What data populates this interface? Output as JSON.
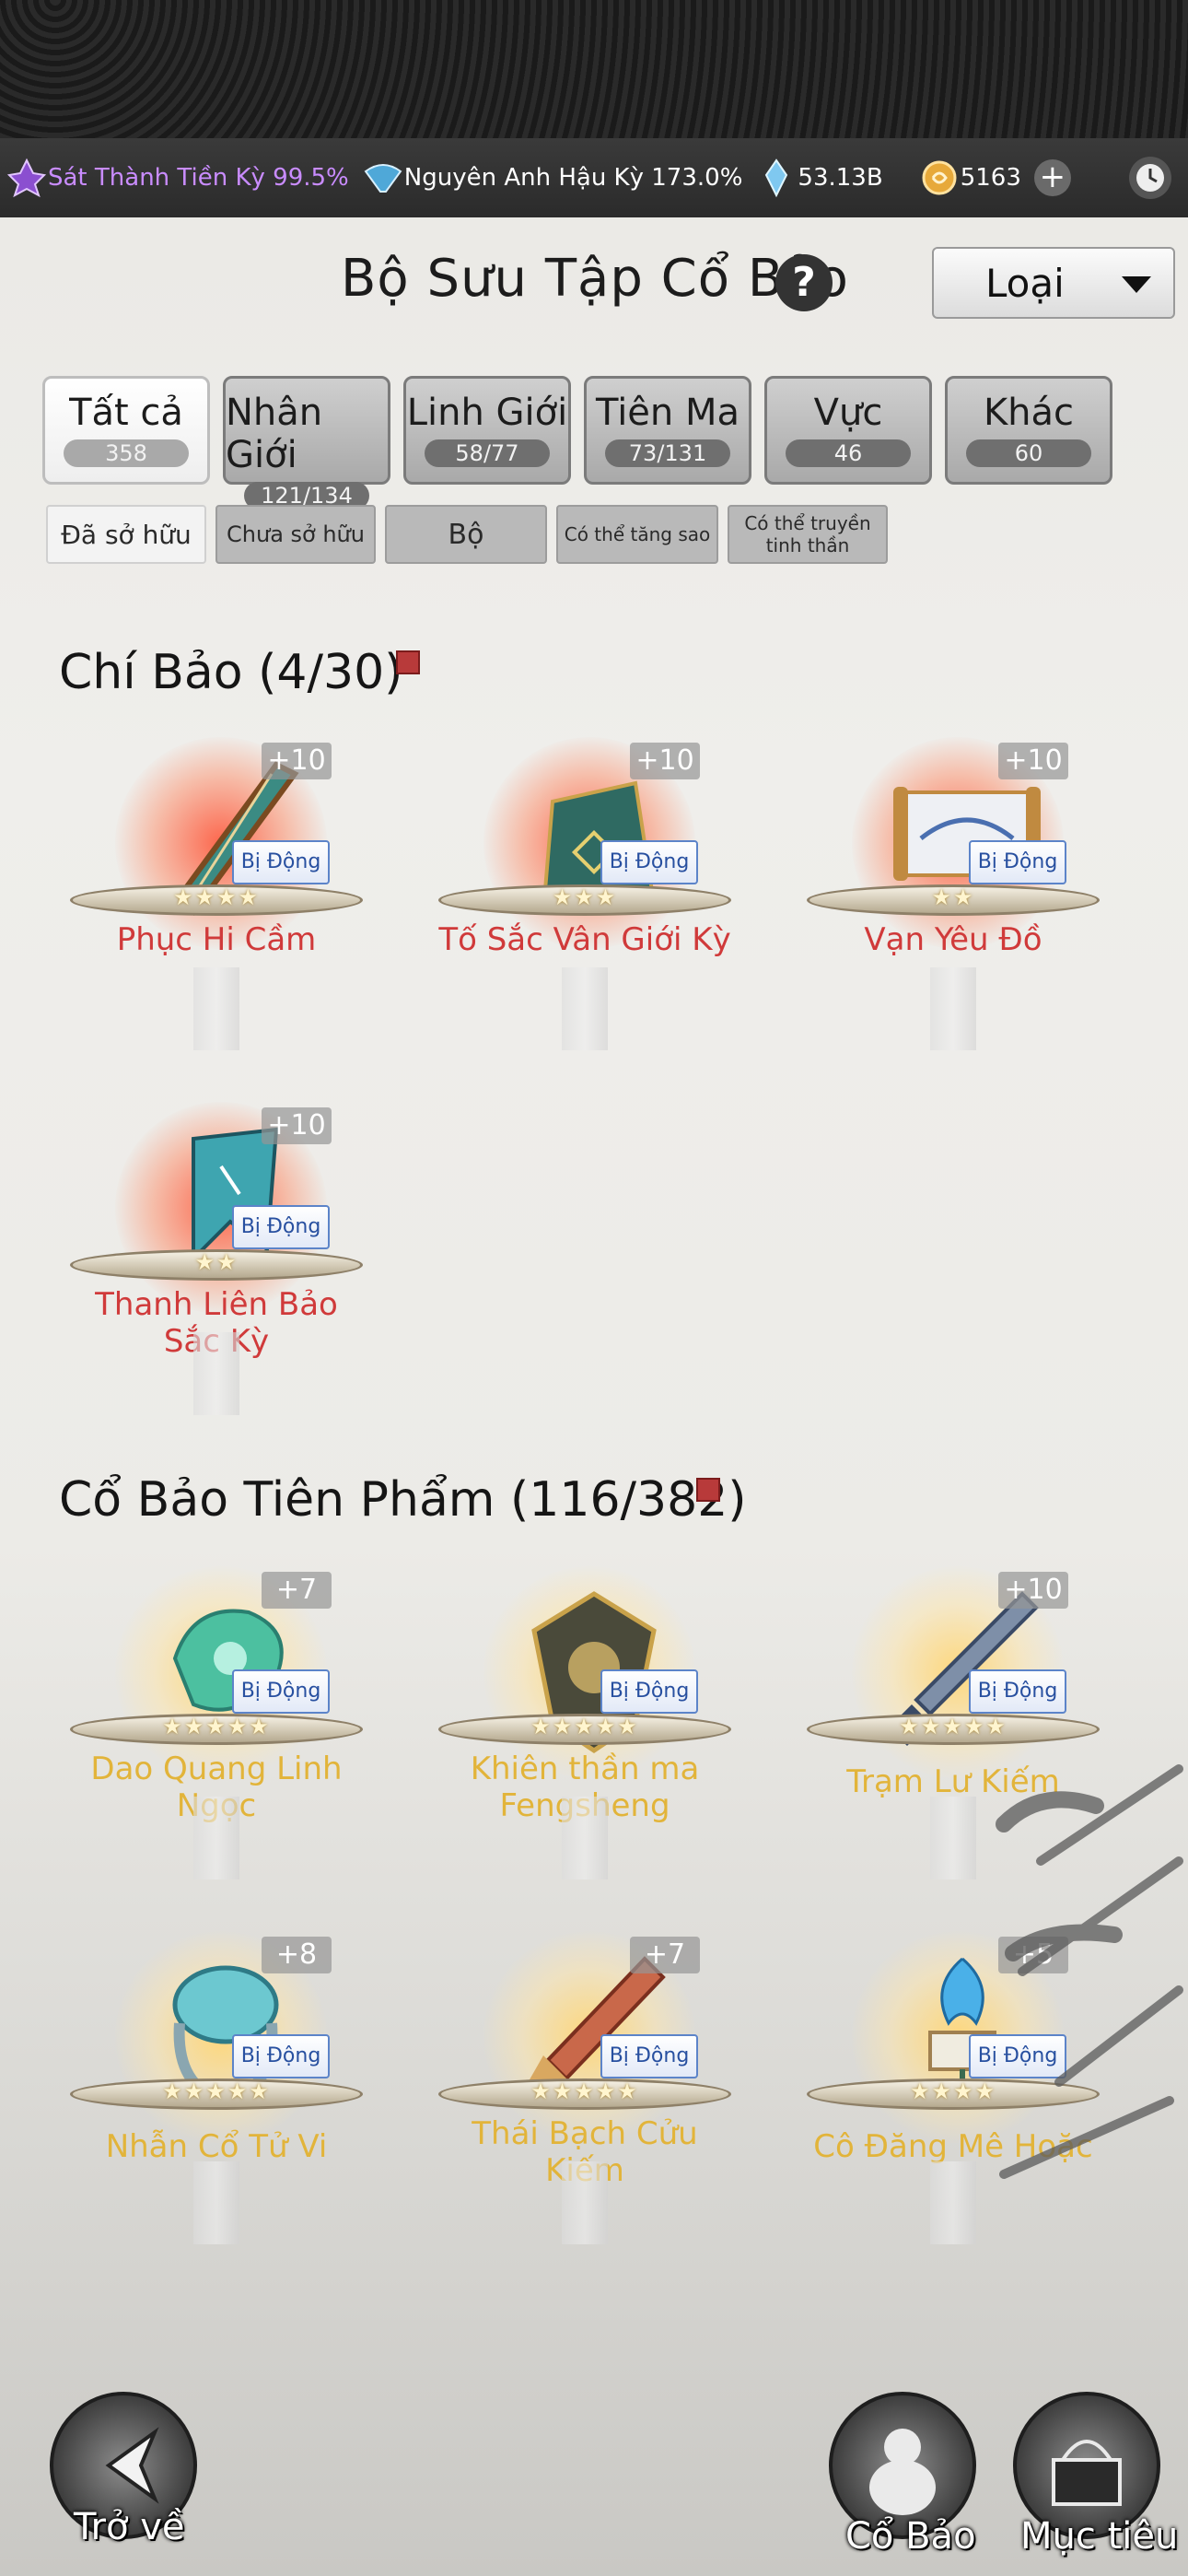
{
  "status_bar": {
    "realm_1": "Sát Thành Tiền Kỳ 99.5%",
    "realm_2": "Nguyên Anh Hậu Kỳ 173.0%",
    "spirit_stone": "53.13B",
    "gold": "5163",
    "plus_icon": "+"
  },
  "header": {
    "title": "Bộ Sưu Tập Cổ Bảo",
    "help": "?",
    "dropdown_label": "Loại"
  },
  "tabs": [
    {
      "label": "Tất cả",
      "count": "358"
    },
    {
      "label": "Nhân Giới",
      "count": "121/134"
    },
    {
      "label": "Linh Giới",
      "count": "58/77"
    },
    {
      "label": "Tiên Ma",
      "count": "73/131"
    },
    {
      "label": "Vực",
      "count": "46"
    },
    {
      "label": "Khác",
      "count": "60"
    }
  ],
  "filters": [
    {
      "label": "Đã sở hữu"
    },
    {
      "label": "Chưa sở hữu"
    },
    {
      "label": "Bộ"
    },
    {
      "label": "Có thể tăng sao"
    },
    {
      "label": "Có thể truyền tinh thần"
    }
  ],
  "sections": [
    {
      "title": "Chí Bảo (4/30)",
      "items": [
        {
          "name": "Phục Hi Cầm",
          "level": "+10",
          "passive": "Bị Động",
          "stars": "★★★★"
        },
        {
          "name": "Tố Sắc Vân Giới Kỳ",
          "level": "+10",
          "passive": "Bị Động",
          "stars": "★★★"
        },
        {
          "name": "Vạn Yêu Đồ",
          "level": "+10",
          "passive": "Bị Động",
          "stars": "★★"
        },
        {
          "name": "Thanh Liên Bảo Sắc Kỳ",
          "level": "+10",
          "passive": "Bị Động",
          "stars": "★★"
        }
      ]
    },
    {
      "title": "Cổ Bảo Tiên Phẩm (116/382)",
      "items": [
        {
          "name": "Dao Quang Linh Ngọc",
          "level": "+7",
          "passive": "Bị Động",
          "stars": "★★★★★"
        },
        {
          "name": "Khiên thần ma Fengsheng",
          "level": "",
          "passive": "Bị Động",
          "stars": "★★★★★"
        },
        {
          "name": "Trạm Lư Kiếm",
          "level": "+10",
          "passive": "Bị Động",
          "stars": "★★★★★"
        },
        {
          "name": "Nhẫn Cổ Tử Vi",
          "level": "+8",
          "passive": "Bị Động",
          "stars": "★★★★★"
        },
        {
          "name": "Thái Bạch Cửu Kiếm",
          "level": "+7",
          "passive": "Bị Động",
          "stars": "★★★★★"
        },
        {
          "name": "Cô Đăng Mê Hoặc",
          "level": "+5",
          "passive": "Bị Động",
          "stars": "★★★★"
        }
      ]
    }
  ],
  "bottom_nav": {
    "back": "Trở về",
    "relics": "Cổ Bảo",
    "goal": "Mục tiêu"
  }
}
